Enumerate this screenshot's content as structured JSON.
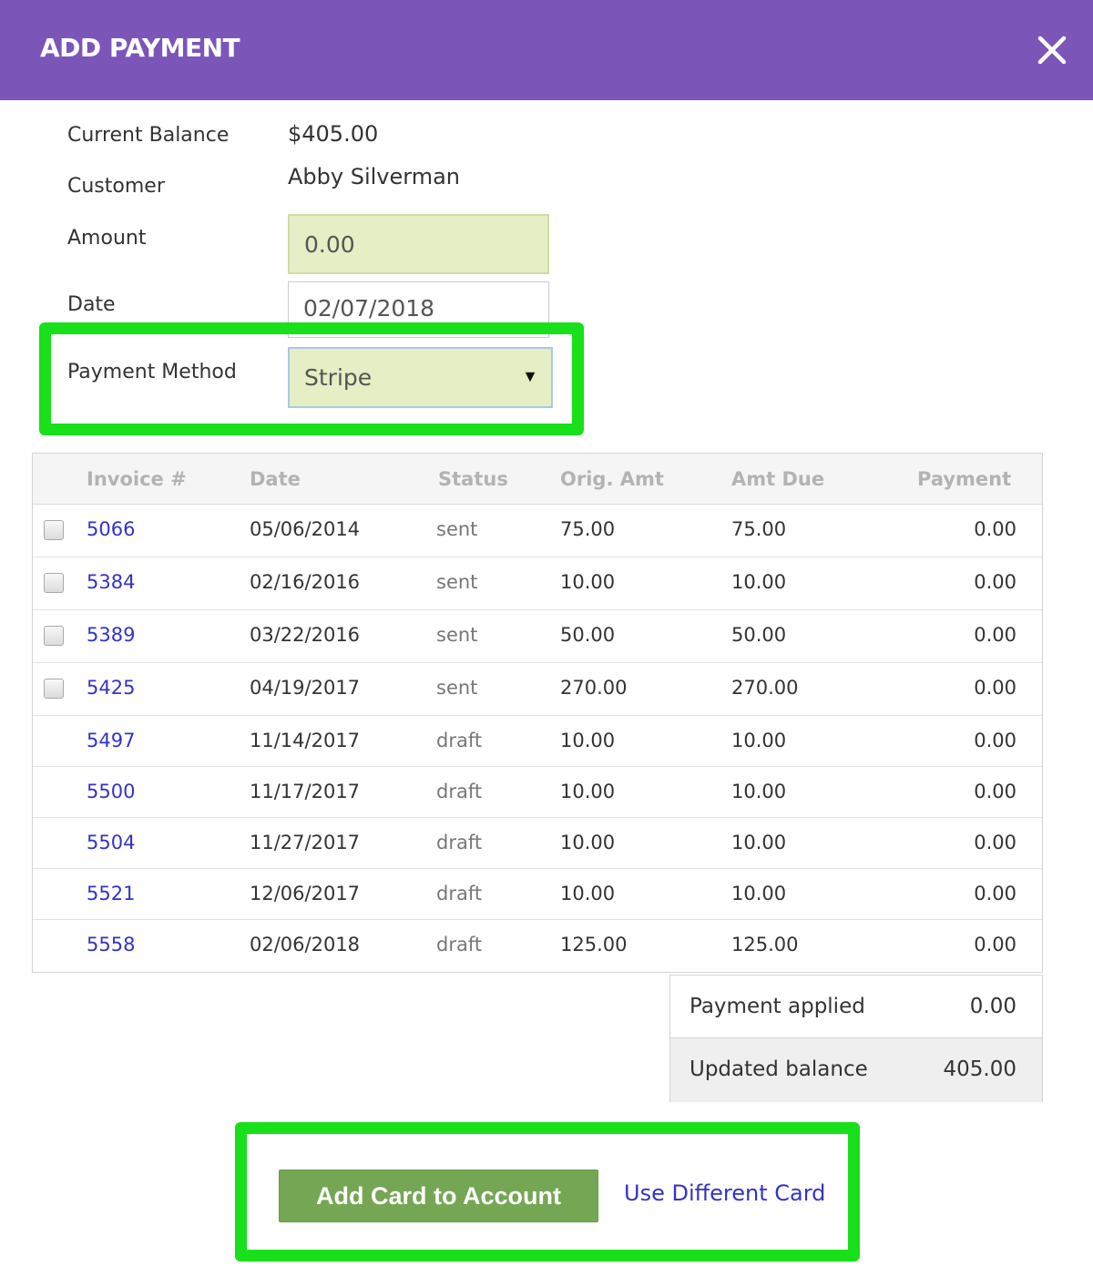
{
  "header": {
    "title": "ADD PAYMENT",
    "background_color": "#7b55b8",
    "close_icon": "close-icon"
  },
  "form": {
    "current_balance_label": "Current Balance",
    "current_balance_value": "$405.00",
    "customer_label": "Customer",
    "customer_value": "Abby Silverman",
    "amount_label": "Amount",
    "amount_value": "0.00",
    "date_label": "Date",
    "date_value": "02/07/2018",
    "payment_method_label": "Payment Method",
    "payment_method_value": "Stripe",
    "dropdown_icon": "caret-down-icon"
  },
  "table": {
    "columns": [
      "Invoice #",
      "Date",
      "Status",
      "Orig. Amt",
      "Amt Due",
      "Payment"
    ],
    "rows": [
      {
        "checkbox": true,
        "invoice": "5066",
        "date": "05/06/2014",
        "status": "sent",
        "orig_amt": "75.00",
        "amt_due": "75.00",
        "payment": "0.00"
      },
      {
        "checkbox": true,
        "invoice": "5384",
        "date": "02/16/2016",
        "status": "sent",
        "orig_amt": "10.00",
        "amt_due": "10.00",
        "payment": "0.00"
      },
      {
        "checkbox": true,
        "invoice": "5389",
        "date": "03/22/2016",
        "status": "sent",
        "orig_amt": "50.00",
        "amt_due": "50.00",
        "payment": "0.00"
      },
      {
        "checkbox": true,
        "invoice": "5425",
        "date": "04/19/2017",
        "status": "sent",
        "orig_amt": "270.00",
        "amt_due": "270.00",
        "payment": "0.00"
      },
      {
        "checkbox": false,
        "invoice": "5497",
        "date": "11/14/2017",
        "status": "draft",
        "orig_amt": "10.00",
        "amt_due": "10.00",
        "payment": "0.00"
      },
      {
        "checkbox": false,
        "invoice": "5500",
        "date": "11/17/2017",
        "status": "draft",
        "orig_amt": "10.00",
        "amt_due": "10.00",
        "payment": "0.00"
      },
      {
        "checkbox": false,
        "invoice": "5504",
        "date": "11/27/2017",
        "status": "draft",
        "orig_amt": "10.00",
        "amt_due": "10.00",
        "payment": "0.00"
      },
      {
        "checkbox": false,
        "invoice": "5521",
        "date": "12/06/2017",
        "status": "draft",
        "orig_amt": "10.00",
        "amt_due": "10.00",
        "payment": "0.00"
      },
      {
        "checkbox": false,
        "invoice": "5558",
        "date": "02/06/2018",
        "status": "draft",
        "orig_amt": "125.00",
        "amt_due": "125.00",
        "payment": "0.00"
      }
    ]
  },
  "summary": {
    "payment_applied_label": "Payment applied",
    "payment_applied_value": "0.00",
    "updated_balance_label": "Updated balance",
    "updated_balance_value": "405.00"
  },
  "actions": {
    "add_card_label": "Add Card to Account",
    "use_different_card_label": "Use Different Card"
  },
  "colors": {
    "highlight": "#18e01a",
    "accent_green": "#74a654",
    "link_blue": "#3333c8",
    "field_fill": "#e5eec4"
  }
}
